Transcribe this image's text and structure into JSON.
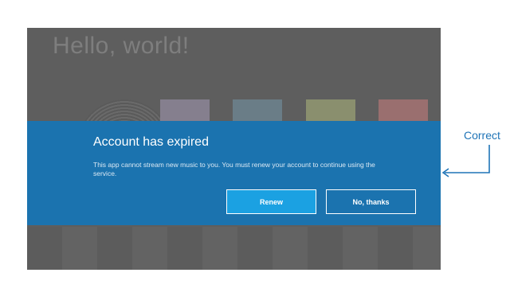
{
  "background_app": {
    "greeting": "Hello, world!"
  },
  "dialog": {
    "title": "Account has expired",
    "message": "This app cannot stream new music to you. You must renew your account to continue using the service.",
    "primary_button": "Renew",
    "secondary_button": "No, thanks"
  },
  "annotation": {
    "label": "Correct"
  },
  "colors": {
    "dialog_background": "#1b73af",
    "primary_button": "#1ba1e2",
    "overlay": "#5e5e5e",
    "annotation": "#1f74b7"
  }
}
